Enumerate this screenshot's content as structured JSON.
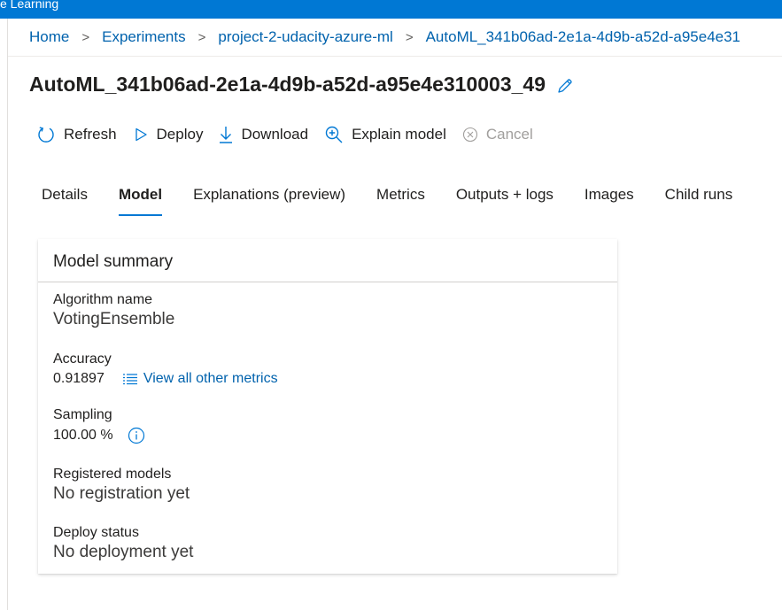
{
  "app": {
    "topbar_text": "e Learning"
  },
  "breadcrumb": {
    "items": [
      "Home",
      "Experiments",
      "project-2-udacity-azure-ml",
      "AutoML_341b06ad-2e1a-4d9b-a52d-a95e4e31"
    ]
  },
  "page": {
    "title": "AutoML_341b06ad-2e1a-4d9b-a52d-a95e4e310003_49"
  },
  "toolbar": {
    "refresh": "Refresh",
    "deploy": "Deploy",
    "download": "Download",
    "explain": "Explain model",
    "cancel": "Cancel"
  },
  "tabs": [
    "Details",
    "Model",
    "Explanations (preview)",
    "Metrics",
    "Outputs + logs",
    "Images",
    "Child runs"
  ],
  "active_tab": "Model",
  "card": {
    "title": "Model summary",
    "algorithm_label": "Algorithm name",
    "algorithm_value": "VotingEnsemble",
    "accuracy_label": "Accuracy",
    "accuracy_value": "0.91897",
    "metrics_link": "View all other metrics",
    "sampling_label": "Sampling",
    "sampling_value": "100.00 %",
    "registered_label": "Registered models",
    "registered_value": "No registration yet",
    "deploy_label": "Deploy status",
    "deploy_value": "No deployment yet"
  },
  "colors": {
    "accent": "#0078d4",
    "link": "#0062ad",
    "disabled": "#a19f9d"
  },
  "icons": [
    "refresh-icon",
    "play-icon",
    "download-icon",
    "zoom-in-icon",
    "cancel-icon",
    "edit-pencil-icon",
    "list-icon",
    "info-icon"
  ]
}
